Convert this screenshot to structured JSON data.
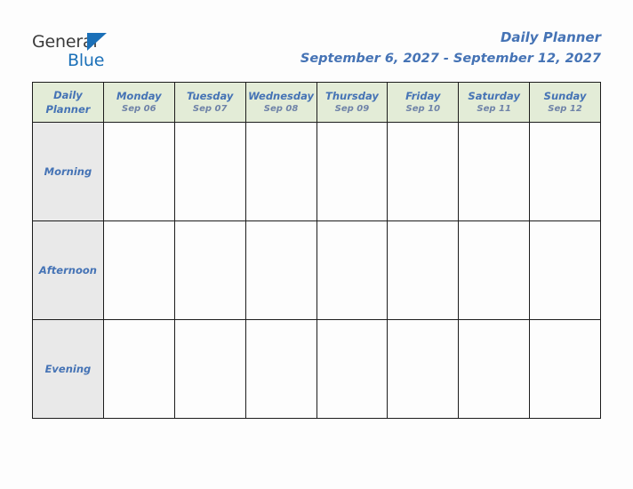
{
  "brand": {
    "line1": "General",
    "line2": "Blue",
    "mark": "triangle-icon",
    "line1_color": "#3b3b3b",
    "line2_color": "#1b70b8"
  },
  "header": {
    "title": "Daily Planner",
    "date_range": "September 6, 2027 - September 12, 2027",
    "title_color": "#4573b5"
  },
  "table": {
    "corner": {
      "line1": "Daily",
      "line2": "Planner"
    },
    "header_bg": "#e3ecd7",
    "label_bg": "#e9e9e9",
    "cell_bg": "#fdfdfd",
    "border_color": "#1c1c1c",
    "columns": [
      {
        "day": "Monday",
        "date": "Sep 06"
      },
      {
        "day": "Tuesday",
        "date": "Sep 07"
      },
      {
        "day": "Wednesday",
        "date": "Sep 08"
      },
      {
        "day": "Thursday",
        "date": "Sep 09"
      },
      {
        "day": "Friday",
        "date": "Sep 10"
      },
      {
        "day": "Saturday",
        "date": "Sep 11"
      },
      {
        "day": "Sunday",
        "date": "Sep 12"
      }
    ],
    "rows": [
      {
        "label": "Morning",
        "cells": [
          "",
          "",
          "",
          "",
          "",
          "",
          ""
        ]
      },
      {
        "label": "Afternoon",
        "cells": [
          "",
          "",
          "",
          "",
          "",
          "",
          ""
        ]
      },
      {
        "label": "Evening",
        "cells": [
          "",
          "",
          "",
          "",
          "",
          "",
          ""
        ]
      }
    ]
  }
}
